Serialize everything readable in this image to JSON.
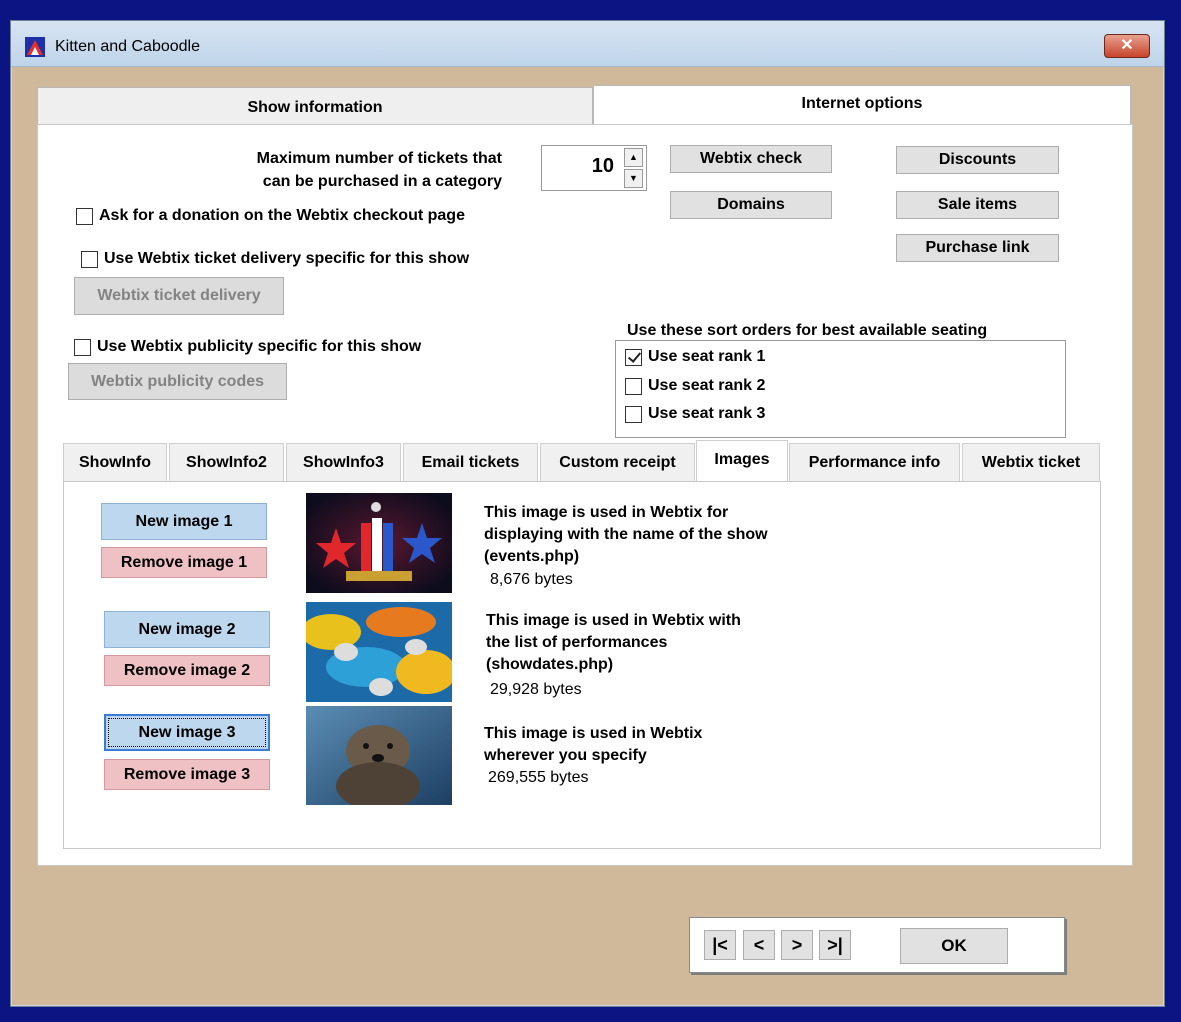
{
  "window": {
    "title": "Kitten and Caboodle",
    "close_label": "✕"
  },
  "main_tabs": [
    {
      "label": "Show information"
    },
    {
      "label": "Internet options"
    }
  ],
  "options": {
    "max_tickets_line1": "Maximum number of tickets that",
    "max_tickets_line2": "can be purchased in a category",
    "max_tickets_value": "10",
    "donation_label": "Ask for a donation on the Webtix checkout page",
    "delivery_checkbox_label": "Use Webtix ticket delivery specific for this show",
    "delivery_button": "Webtix ticket delivery",
    "publicity_checkbox_label": "Use Webtix publicity specific for this show",
    "publicity_button": "Webtix publicity codes",
    "webtix_check": "Webtix check",
    "domains": "Domains",
    "discounts": "Discounts",
    "sale_items": "Sale items",
    "purchase_link": "Purchase link",
    "sort_heading": "Use these sort orders for best available seating",
    "seat_ranks": [
      {
        "label": "Use seat rank 1",
        "checked": true
      },
      {
        "label": "Use seat rank 2",
        "checked": false
      },
      {
        "label": "Use seat rank 3",
        "checked": false
      }
    ]
  },
  "sub_tabs": [
    {
      "label": "ShowInfo"
    },
    {
      "label": "ShowInfo2"
    },
    {
      "label": "ShowInfo3"
    },
    {
      "label": "Email tickets"
    },
    {
      "label": "Custom receipt"
    },
    {
      "label": "Images"
    },
    {
      "label": "Performance info"
    },
    {
      "label": "Webtix ticket"
    }
  ],
  "images": [
    {
      "new_label": "New image 1",
      "remove_label": "Remove image 1",
      "desc": [
        "This image is used in Webtix for",
        "displaying with the name of the show",
        "(events.php)"
      ],
      "bytes": "8,676 bytes"
    },
    {
      "new_label": "New image 2",
      "remove_label": "Remove image 2",
      "desc": [
        "This image is used in Webtix with",
        "the list of performances",
        "(showdates.php)"
      ],
      "bytes": "29,928 bytes"
    },
    {
      "new_label": "New image 3",
      "remove_label": "Remove image 3",
      "desc": [
        "This image is used in Webtix",
        "wherever you specify"
      ],
      "bytes": "269,555 bytes"
    }
  ],
  "nav": {
    "first": "|<",
    "prev": "<",
    "next": ">",
    "last": ">|",
    "ok": "OK"
  }
}
